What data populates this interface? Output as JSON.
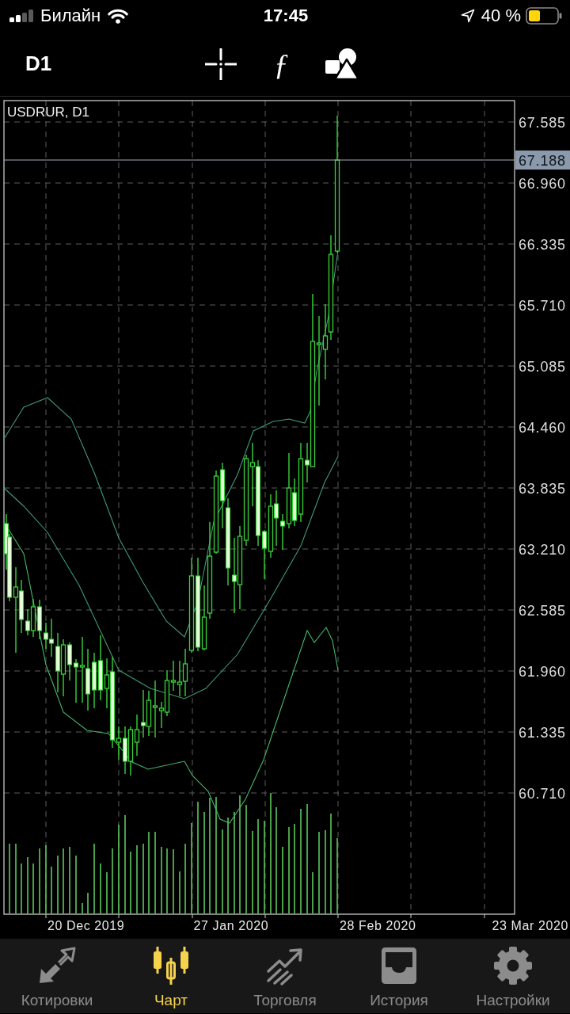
{
  "status_bar": {
    "carrier": "Билайн",
    "time": "17:45",
    "battery": "40 %"
  },
  "toolbar": {
    "timeframe": "D1",
    "indicator_glyph": "ƒ"
  },
  "chart": {
    "title": "USDRUR, D1",
    "price_axis": [
      "67.585",
      "66.960",
      "66.335",
      "65.710",
      "65.085",
      "64.460",
      "63.835",
      "63.210",
      "62.585",
      "61.960",
      "61.335",
      "60.710"
    ],
    "current_price": "67.188",
    "date_axis": [
      "20 Dec 2019",
      "27 Jan 2020",
      "28 Feb 2020",
      "23 Mar 2020"
    ]
  },
  "tabs": [
    {
      "label": "Котировки",
      "selected": false
    },
    {
      "label": "Чарт",
      "selected": true
    },
    {
      "label": "Торговля",
      "selected": false
    },
    {
      "label": "История",
      "selected": false
    },
    {
      "label": "Настройки",
      "selected": false
    }
  ]
}
